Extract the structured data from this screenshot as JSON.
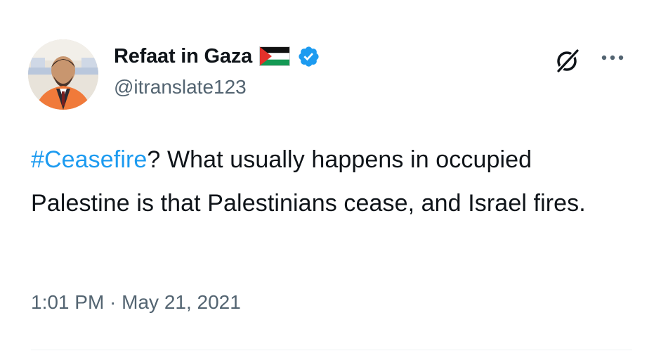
{
  "author": {
    "display_name": "Refaat in Gaza",
    "handle": "@itranslate123",
    "verified": true,
    "flag_icon": "palestine-flag-icon",
    "verified_icon": "verified-badge-icon"
  },
  "tweet": {
    "hashtag": "#Ceasefire",
    "text_after_hashtag": "? What usually happens in occupied Palestine is that Palestinians cease, and Israel fires.",
    "timestamp": "1:01 PM · May 21, 2021"
  },
  "actions": {
    "grok_icon": "grok-icon",
    "more_icon": "more-options-icon"
  },
  "colors": {
    "text": "#0f1419",
    "secondary_text": "#536471",
    "link": "#1d9bf0",
    "verified": "#1d9bf0",
    "divider": "#eff3f4"
  }
}
